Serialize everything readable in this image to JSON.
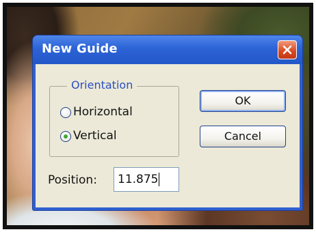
{
  "dialog": {
    "title": "New Guide",
    "orientation": {
      "legend": "Orientation",
      "options": [
        {
          "label": "Horizontal",
          "selected": false
        },
        {
          "label": "Vertical",
          "selected": true
        }
      ]
    },
    "buttons": {
      "ok": "OK",
      "cancel": "Cancel"
    },
    "position": {
      "label": "Position:",
      "value": "11.875"
    }
  },
  "icons": {
    "close": "close-icon"
  },
  "colors": {
    "titlebar": "#2c63d6",
    "client_bg": "#ece9d8",
    "legend_text": "#2c4ec1",
    "close_button": "#d8471f",
    "radio_selected_dot": "#3fa72f"
  }
}
